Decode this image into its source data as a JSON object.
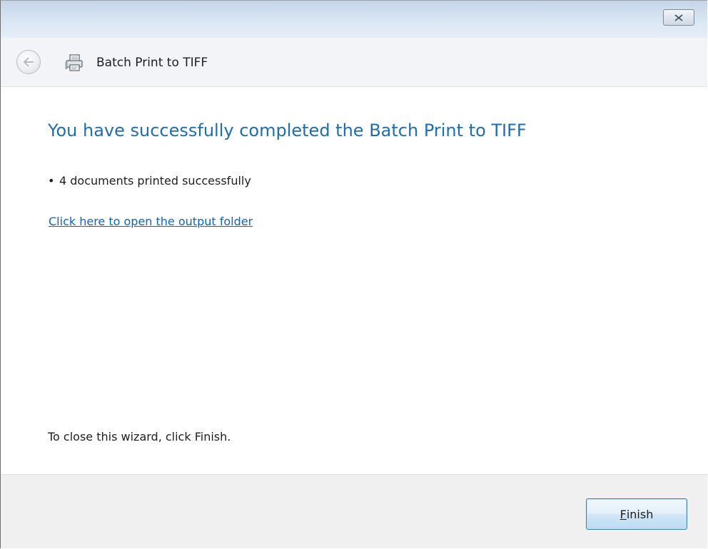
{
  "window": {
    "close_icon": "close-x-icon"
  },
  "header": {
    "back_icon": "back-arrow-icon",
    "app_icon": "printer-icon",
    "title": "Batch Print to TIFF"
  },
  "content": {
    "heading": "You have successfully completed the Batch Print to TIFF",
    "bullet": "•",
    "result_text": "4 documents printed successfully",
    "output_link": "Click here to open the output folder",
    "close_hint": "To close this wizard, click Finish."
  },
  "footer": {
    "finish_access_key": "F",
    "finish_rest": "inish"
  },
  "colors": {
    "heading": "#1e6eb0",
    "link": "#0b66c2",
    "titlebar": "#d9e6f4",
    "footer": "#f0f0f0"
  }
}
